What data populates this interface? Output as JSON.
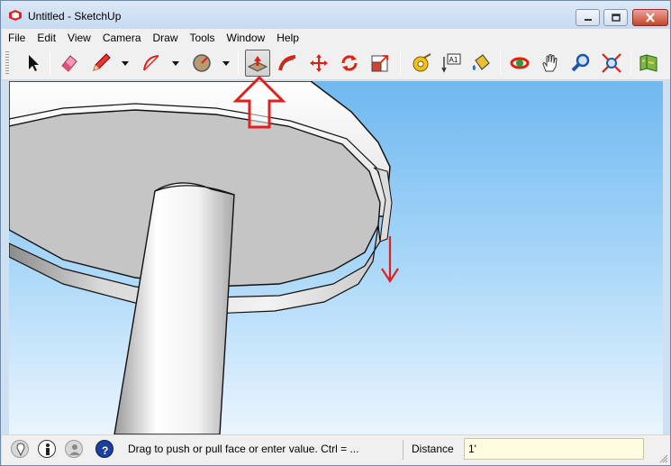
{
  "window": {
    "title": "Untitled - SketchUp",
    "app_icon": "sketchup-logo-icon",
    "controls": [
      "minimize-icon",
      "maximize-icon",
      "close-icon"
    ]
  },
  "menubar": {
    "items": [
      {
        "label": "File"
      },
      {
        "label": "Edit"
      },
      {
        "label": "View"
      },
      {
        "label": "Camera"
      },
      {
        "label": "Draw"
      },
      {
        "label": "Tools"
      },
      {
        "label": "Window"
      },
      {
        "label": "Help"
      }
    ]
  },
  "toolbar": {
    "tools": [
      {
        "name": "select",
        "icon": "arrow-cursor-icon"
      },
      {
        "name": "eraser",
        "icon": "eraser-icon"
      },
      {
        "name": "line",
        "icon": "pencil-icon",
        "dropdown": true
      },
      {
        "name": "arc",
        "icon": "arc-icon",
        "dropdown": true
      },
      {
        "name": "shapes",
        "icon": "circle-shape-icon",
        "dropdown": true
      },
      {
        "name": "push-pull",
        "icon": "push-pull-icon",
        "active": true
      },
      {
        "name": "offset",
        "icon": "follow-me-icon"
      },
      {
        "name": "move",
        "icon": "move-icon"
      },
      {
        "name": "rotate",
        "icon": "rotate-icon"
      },
      {
        "name": "scale",
        "icon": "scale-icon"
      },
      {
        "name": "tape-measure",
        "icon": "tape-measure-icon"
      },
      {
        "name": "text",
        "icon": "text-label-icon"
      },
      {
        "name": "paint-bucket",
        "icon": "paint-bucket-icon"
      },
      {
        "name": "orbit",
        "icon": "orbit-icon"
      },
      {
        "name": "pan",
        "icon": "hand-icon"
      },
      {
        "name": "zoom",
        "icon": "magnifier-icon"
      },
      {
        "name": "zoom-extents",
        "icon": "zoom-extents-icon"
      },
      {
        "name": "warehouse",
        "icon": "3d-warehouse-icon"
      }
    ],
    "text_tool_label": "A1"
  },
  "status": {
    "hint": "Drag to push or pull face or enter value.  Ctrl = ...",
    "distance_label": "Distance",
    "distance_value": "1'"
  },
  "colors": {
    "annotation_red": "#e02020",
    "sky_top": "#6fb8f0",
    "sky_bottom": "#eaf5fd"
  }
}
